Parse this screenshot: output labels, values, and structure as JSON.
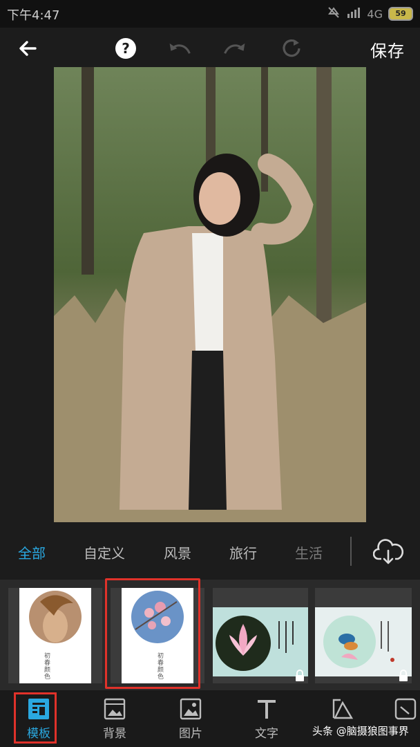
{
  "status": {
    "time": "下午4:47",
    "network": "4G",
    "battery": "59"
  },
  "toolbar": {
    "save_label": "保存",
    "help_symbol": "?"
  },
  "categories": [
    {
      "label": "全部",
      "active": true
    },
    {
      "label": "自定义",
      "active": false
    },
    {
      "label": "风景",
      "active": false
    },
    {
      "label": "旅行",
      "active": false
    },
    {
      "label": "生活",
      "active": false
    }
  ],
  "templates": [
    {
      "caption": "初春颜色",
      "locked": false
    },
    {
      "caption": "初春颜色",
      "locked": false,
      "selected": true
    },
    {
      "caption": "",
      "locked": true
    },
    {
      "caption": "",
      "locked": true
    }
  ],
  "nav": [
    {
      "label": "模板",
      "icon": "template-icon",
      "active": true
    },
    {
      "label": "背景",
      "icon": "background-icon",
      "active": false
    },
    {
      "label": "图片",
      "icon": "image-icon",
      "active": false
    },
    {
      "label": "文字",
      "icon": "text-icon",
      "active": false
    }
  ],
  "watermark": "头条 @脑摄狼图事界",
  "colors": {
    "accent": "#2aa8e0",
    "highlight": "#e0322a"
  }
}
